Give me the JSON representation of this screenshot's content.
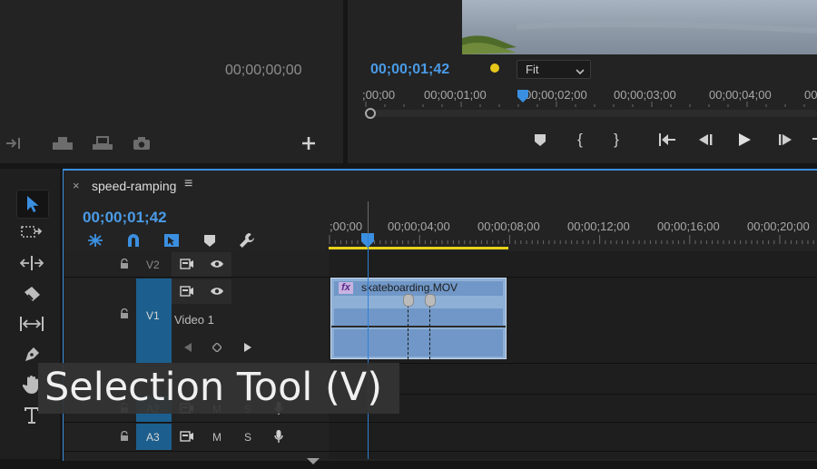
{
  "source_monitor": {
    "timecode": "00;00;00;00"
  },
  "program_monitor": {
    "timecode": "00;00;01;42",
    "fit_select": "Fit",
    "ruler_labels": [
      ";00;00",
      "00;00;01;00",
      "00;00;02;00",
      "00;00;03;00",
      "00;00;04;00",
      "00"
    ]
  },
  "timeline": {
    "close_glyph": "×",
    "sequence_name": "speed-ramping",
    "menu_glyph": "≡",
    "timecode": "00;00;01;42",
    "ruler_labels": [
      ";00;00",
      "00;00;04;00",
      "00;00;08;00",
      "00;00;12;00",
      "00;00;16;00",
      "00;00;20;00"
    ],
    "tracks": {
      "v2": {
        "label": "V2"
      },
      "v1": {
        "label": "V1",
        "name": "Video 1"
      },
      "a2": {
        "label": "A2",
        "mute": "M",
        "solo": "S"
      },
      "a3": {
        "label": "A3",
        "mute": "M",
        "solo": "S"
      }
    },
    "clip": {
      "fx_badge": "fx",
      "name": "skateboarding.MOV"
    }
  },
  "tooltip": {
    "text": "Selection Tool (V)"
  },
  "colors": {
    "accent_blue": "#3b8fe0",
    "track_target": "#1c5f8e",
    "clip_fill": "#8fb0d6",
    "work_area_yellow": "#e7d21a",
    "playhead": "#2f7fd6"
  }
}
